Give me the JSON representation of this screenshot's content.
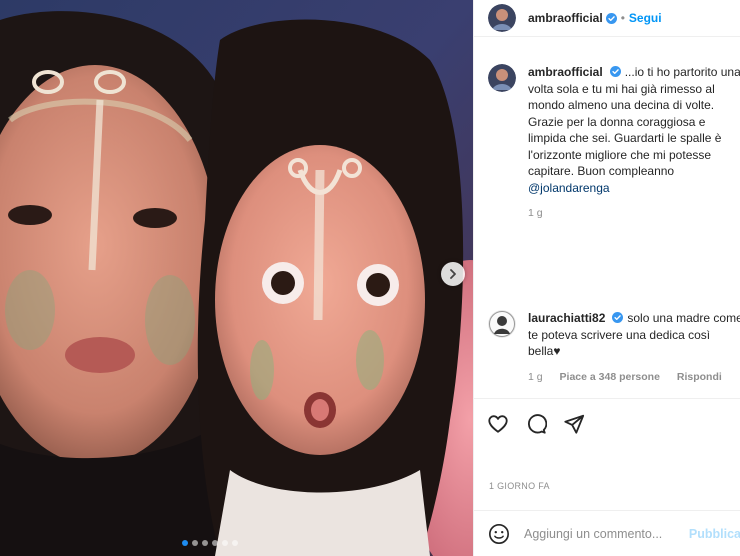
{
  "post": {
    "author": {
      "username": "ambraofficial",
      "verified": true,
      "follow_label": "Segui",
      "separator": "•"
    },
    "caption": {
      "username": "ambraofficial",
      "text": "...io ti ho partorito una volta sola e tu mi hai già rimesso al mondo almeno una decina di volte. Grazie per la donna coraggiosa e limpida che sei. Guardarti le spalle è l'orizzonte migliore che mi potesse capitare. Buon compleanno",
      "mention": "@jolandarenga",
      "time": "1 g"
    },
    "comments": [
      {
        "username": "laurachiatti82",
        "verified": true,
        "text": "solo una madre come te poteva scrivere una dedica così bella♥",
        "time": "1 g",
        "likes_label": "Piace a 348 persone",
        "reply_label": "Rispondi"
      }
    ],
    "carousel": {
      "total": 6,
      "active_index": 0
    },
    "time_ago": "1 GIORNO FA"
  },
  "icons": {
    "like": "heart-icon",
    "comment": "comment-icon",
    "share": "send-icon",
    "emoji": "emoji-icon",
    "next": "chevron-right-icon",
    "verified": "verified-badge-icon"
  },
  "composer": {
    "placeholder": "Aggiungi un commento...",
    "publish_label": "Pubblica"
  },
  "colors": {
    "accent_blue": "#0095f6",
    "verified_blue": "#3897f0",
    "muted_text": "#8e8e8e",
    "publish_disabled": "#b2dffc"
  }
}
